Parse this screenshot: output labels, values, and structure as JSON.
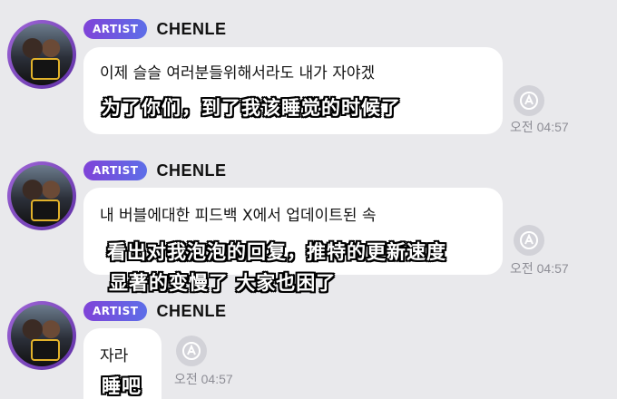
{
  "messages": [
    {
      "badge": "ARTIST",
      "sender": "CHENLE",
      "text": "이제 슬슬 여러분들위해서라도 내가 자야겠",
      "subtitle_lines": [
        "为了你们，到了我该睡觉的时候了"
      ],
      "time": "오전 04:57"
    },
    {
      "badge": "ARTIST",
      "sender": "CHENLE",
      "text": "내 버블에대한 피드백 X에서 업데이트된 속",
      "subtitle_lines": [
        "看出对我泡泡的回复，推特的更新速度",
        "显著的变慢了 大家也困了"
      ],
      "time": "오전 04:57"
    },
    {
      "badge": "ARTIST",
      "sender": "CHENLE",
      "text": "자라",
      "subtitle_lines": [
        "睡吧"
      ],
      "time": "오전 04:57"
    }
  ],
  "icons": {
    "reaction": "reaction-add-icon",
    "avatar": "profile-photo"
  },
  "colors": {
    "badge_start": "#7f43d8",
    "badge_end": "#5d6ee8",
    "background": "#e9e9ec",
    "bubble": "#ffffff",
    "time": "#8e8e96"
  }
}
